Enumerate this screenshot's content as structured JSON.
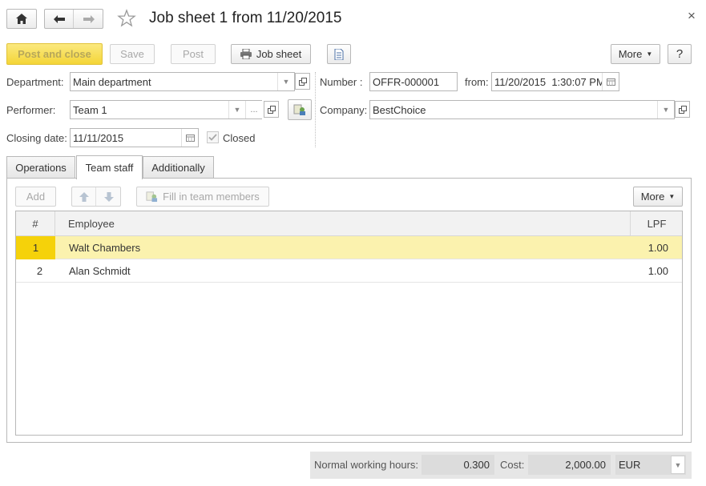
{
  "window": {
    "title": "Job sheet 1 from 11/20/2015",
    "home_icon": "home-icon",
    "back_icon": "arrow-left-icon",
    "forward_icon": "arrow-right-icon",
    "favorite_icon": "star-icon",
    "close_glyph": "×"
  },
  "toolbar": {
    "post_and_close": "Post and close",
    "save": "Save",
    "post": "Post",
    "job_sheet": "Job sheet",
    "more": "More",
    "help": "?"
  },
  "form": {
    "department_label": "Department:",
    "department_value": "Main department",
    "performer_label": "Performer:",
    "performer_value": "Team 1",
    "closing_date_label": "Closing date:",
    "closing_date_value": "11/11/2015",
    "closed_label": "Closed",
    "closed_checked": true,
    "number_label": "Number :",
    "number_value": "OFFR-000001",
    "from_label": "from:",
    "from_value": "11/20/2015  1:30:07 PM",
    "company_label": "Company:",
    "company_value": "BestChoice"
  },
  "tabs": [
    "Operations",
    "Team staff",
    "Additionally"
  ],
  "active_tab": "Team staff",
  "team_toolbar": {
    "add": "Add",
    "fill": "Fill in team members",
    "more": "More"
  },
  "table": {
    "columns": [
      "#",
      "Employee",
      "LPF"
    ],
    "rows": [
      {
        "num": "1",
        "employee": "Walt Chambers",
        "lpf": "1.00",
        "selected": true
      },
      {
        "num": "2",
        "employee": "Alan Schmidt",
        "lpf": "1.00",
        "selected": false
      }
    ]
  },
  "footer": {
    "hours_label": "Normal working hours:",
    "hours_value": "0.300",
    "cost_label": "Cost:",
    "cost_value": "2,000.00",
    "currency": "EUR"
  },
  "colors": {
    "primary_button": "#f4d537",
    "selected_row": "#fbf2ae",
    "selected_num_cell": "#f5d20a"
  }
}
